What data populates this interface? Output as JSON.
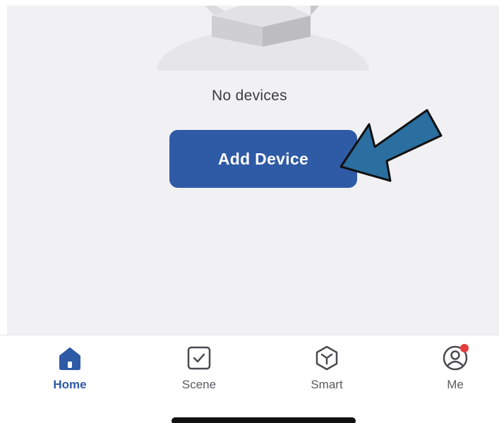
{
  "empty_state": {
    "message": "No devices",
    "add_button_label": "Add Device"
  },
  "tabs": [
    {
      "label": "Home",
      "icon": "home-icon",
      "active": true
    },
    {
      "label": "Scene",
      "icon": "scene-checkbox-icon",
      "active": false
    },
    {
      "label": "Smart",
      "icon": "smart-cube-icon",
      "active": false
    },
    {
      "label": "Me",
      "icon": "profile-icon",
      "active": false,
      "notification_badge": true
    }
  ],
  "colors": {
    "accent": "#2f5aa6",
    "content_background": "#f1f1f4",
    "annotation_arrow": "#2b6ea0",
    "badge": "#e43b3b"
  }
}
